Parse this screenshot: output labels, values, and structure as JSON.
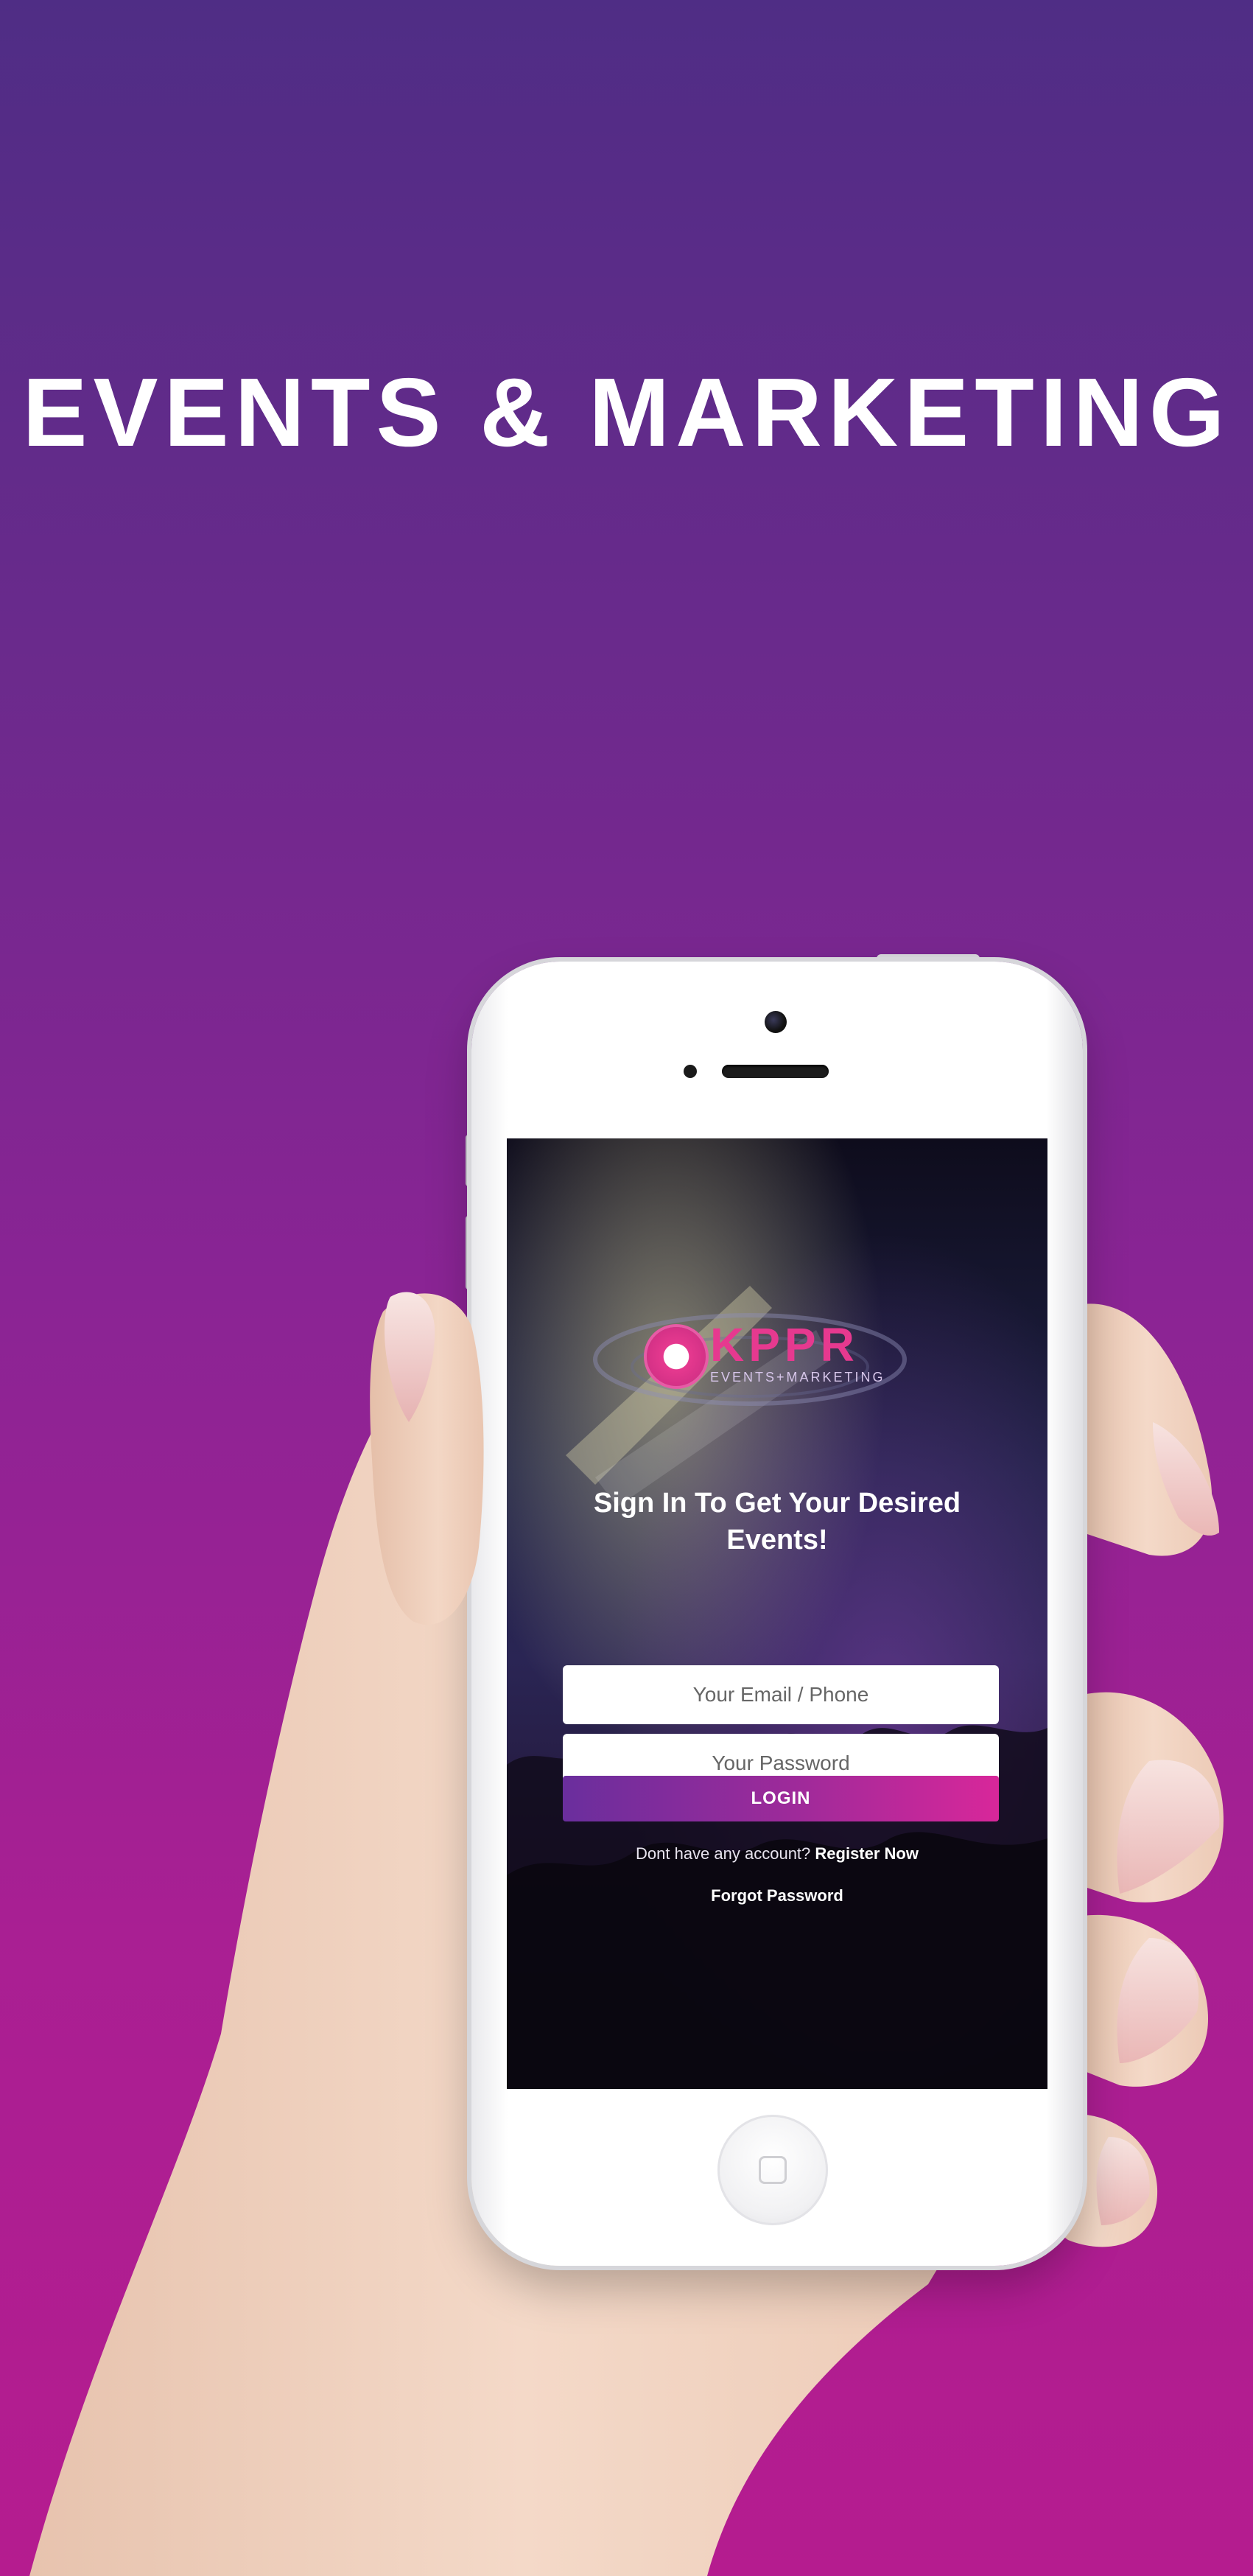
{
  "page": {
    "headline": "EVENTS & MARKETING",
    "colors": {
      "background_top": "#4f2d85",
      "background_bottom": "#b51c8f",
      "brand_pink": "#e6398f",
      "login_gradient_start": "#6a2e9d",
      "login_gradient_end": "#d8279a"
    }
  },
  "app_screen": {
    "logo": {
      "wordmark": "KPPR",
      "tagline": "EVENTS+MARKETING"
    },
    "title": "Sign In To Get Your Desired Events!",
    "email_field": {
      "placeholder": "Your Email / Phone",
      "value": ""
    },
    "password_field": {
      "placeholder": "Your Password",
      "value": ""
    },
    "login_button": "LOGIN",
    "register_prompt": "Dont have any account? ",
    "register_link": "Register Now",
    "forgot_password": "Forgot Password"
  }
}
